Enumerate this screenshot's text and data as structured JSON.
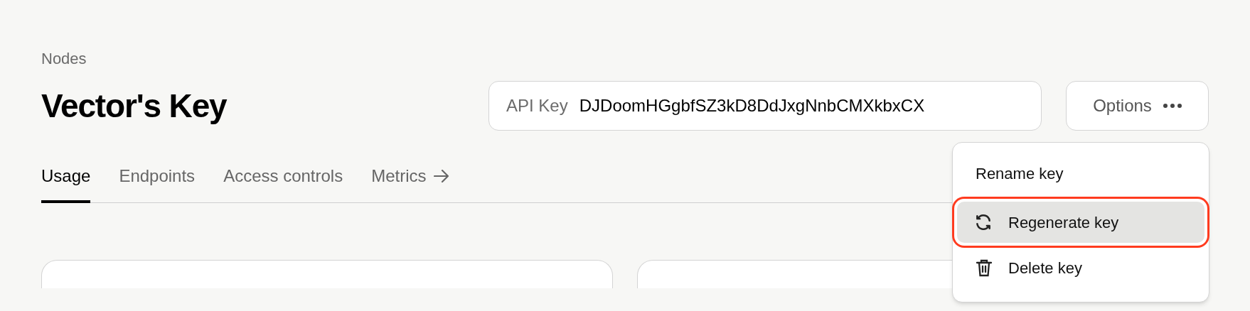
{
  "breadcrumb": "Nodes",
  "title": "Vector's Key",
  "api_key": {
    "label": "API Key",
    "value": "DJDoomHGgbfSZ3kD8DdJxgNnbCMXkbxCX"
  },
  "options_button": {
    "label": "Options"
  },
  "tabs": [
    {
      "label": "Usage",
      "selected": true,
      "kind": "tab"
    },
    {
      "label": "Endpoints",
      "selected": false,
      "kind": "tab"
    },
    {
      "label": "Access controls",
      "selected": false,
      "kind": "tab"
    },
    {
      "label": "Metrics",
      "selected": false,
      "kind": "link"
    }
  ],
  "options_menu": [
    {
      "label": "Rename key",
      "kind": "plain",
      "selected": false,
      "highlighted": false
    },
    {
      "label": "Regenerate key",
      "kind": "regenerate",
      "selected": true,
      "highlighted": true
    },
    {
      "label": "Delete key",
      "kind": "delete",
      "selected": false,
      "highlighted": false
    }
  ]
}
